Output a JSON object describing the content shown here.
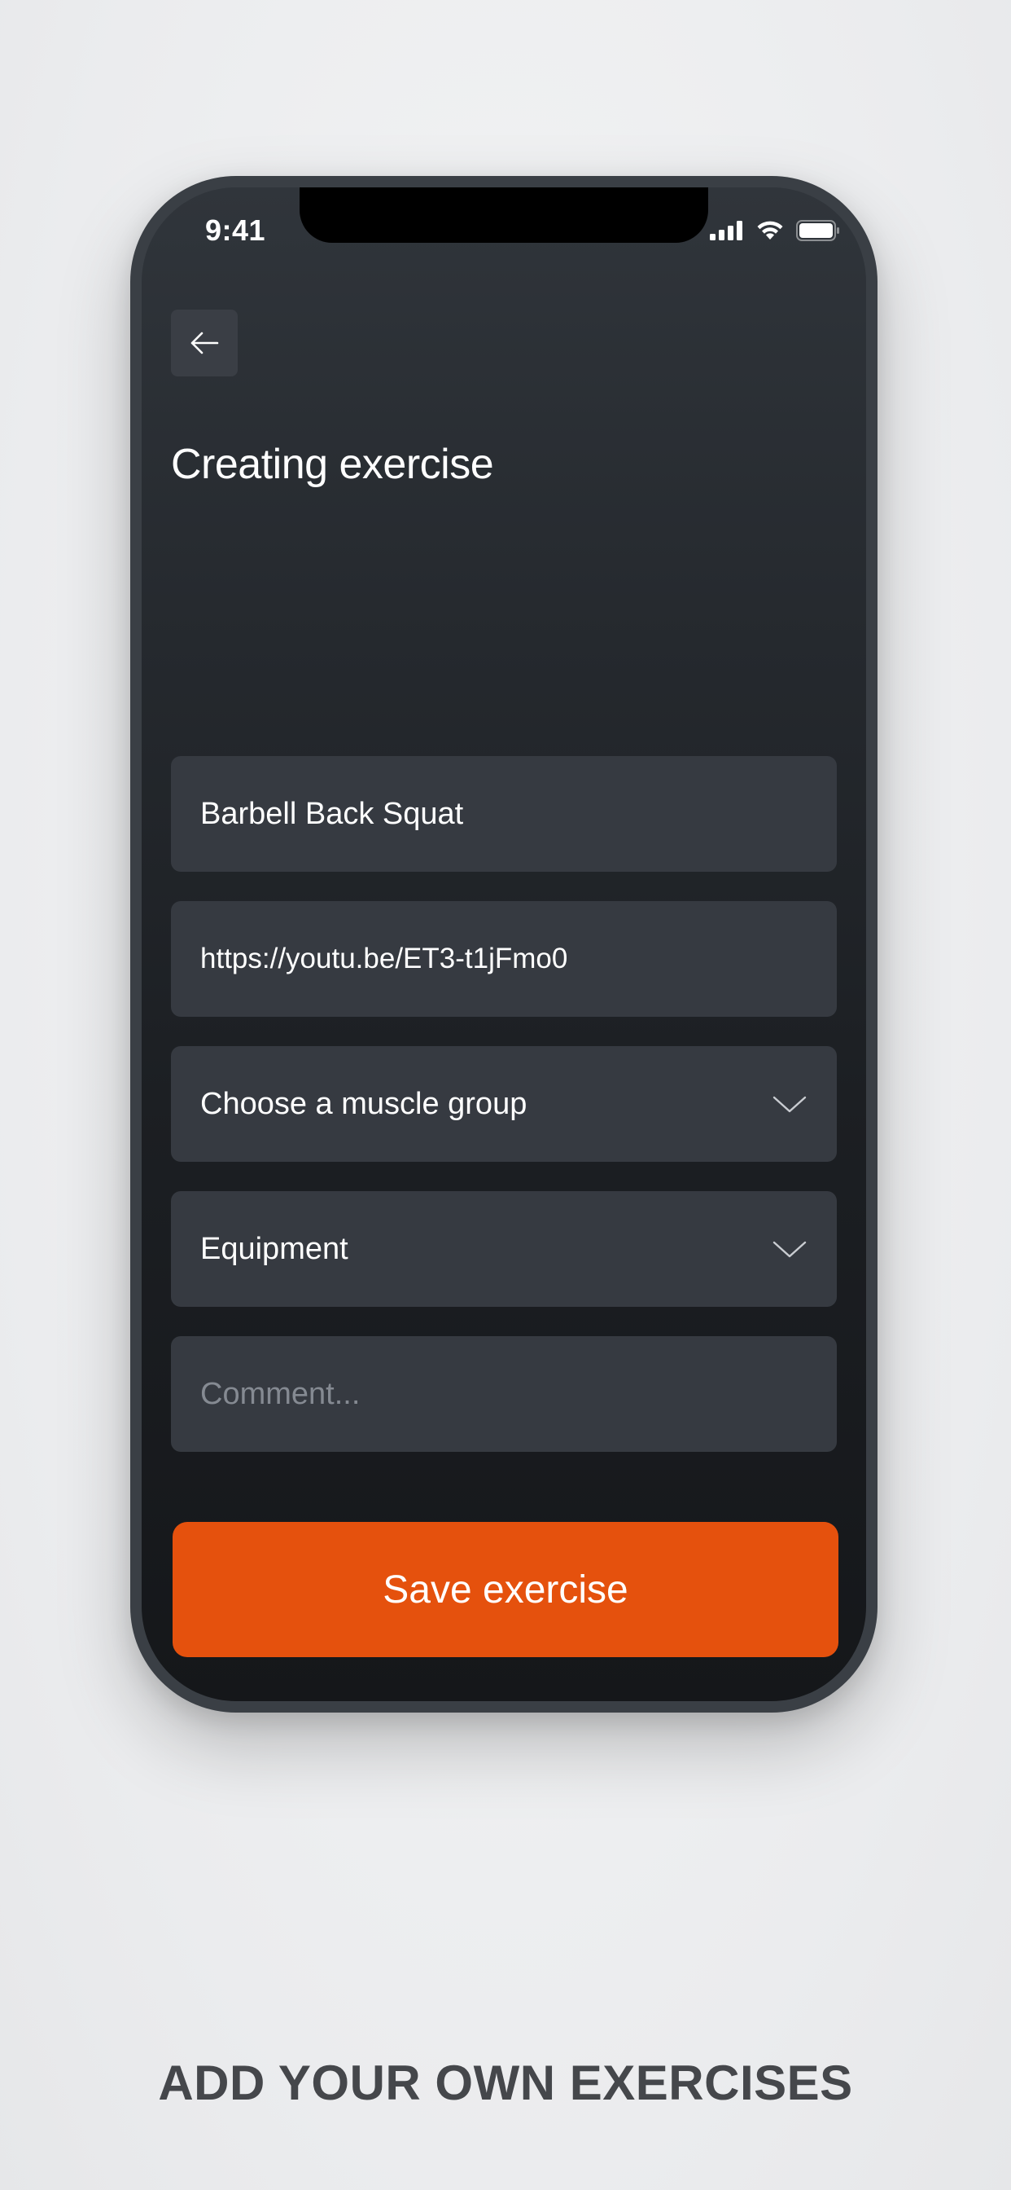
{
  "status_bar": {
    "time": "9:41",
    "icons": [
      "signal-icon",
      "wifi-icon",
      "battery-icon"
    ]
  },
  "header": {
    "back_icon": "arrow-left-icon",
    "title": "Creating exercise"
  },
  "form": {
    "name_value": "Barbell Back Squat",
    "video_url_value": "https://youtu.be/ET3-t1jFmo0",
    "muscle_group_label": "Choose a muscle group",
    "equipment_label": "Equipment",
    "comment_placeholder": "Comment...",
    "dropdown_icon": "chevron-down-icon"
  },
  "actions": {
    "save_label": "Save exercise"
  },
  "caption": "ADD YOUR OWN EXERCISES",
  "colors": {
    "accent": "#e5510d",
    "field_bg": "#363a41",
    "screen_bg_top": "#30353b",
    "screen_bg_bottom": "#15171a",
    "caption_text": "#45474b",
    "page_bg": "#eeeff0"
  }
}
